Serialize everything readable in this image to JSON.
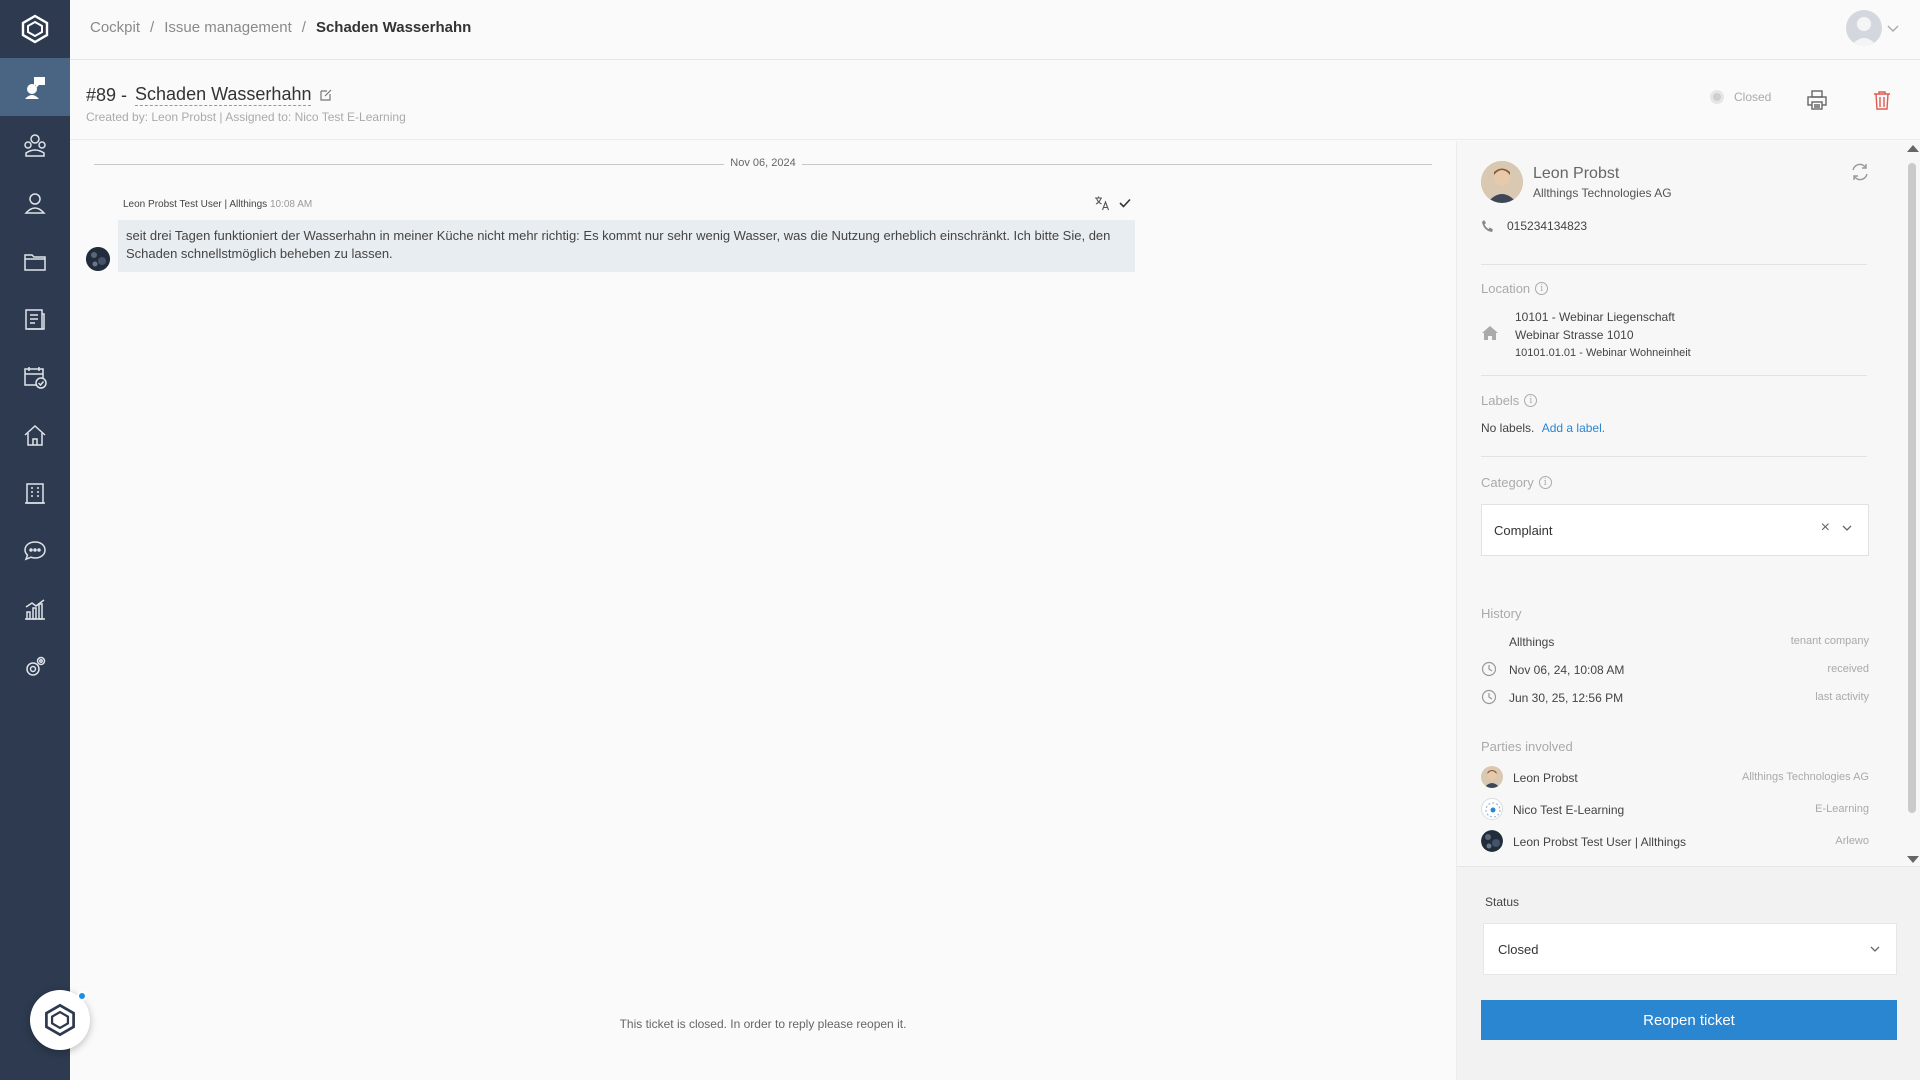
{
  "breadcrumb": {
    "items": [
      "Cockpit",
      "Issue management"
    ],
    "separator": "/",
    "current": "Schaden Wasserhahn"
  },
  "sidebar": {
    "items": [
      {
        "icon": "issue-management-icon",
        "active": true
      },
      {
        "icon": "team-icon"
      },
      {
        "icon": "user-icon"
      },
      {
        "icon": "folder-icon"
      },
      {
        "icon": "document-icon"
      },
      {
        "icon": "calendar-check-icon"
      },
      {
        "icon": "home-icon"
      },
      {
        "icon": "building-icon"
      },
      {
        "icon": "chat-icon"
      },
      {
        "icon": "analytics-icon"
      },
      {
        "icon": "settings-icon"
      }
    ]
  },
  "ticket": {
    "number": "#89 -",
    "title": "Schaden Wasserhahn",
    "meta": "Created by: Leon Probst | Assigned to: Nico Test E-Learning",
    "status_text": "Closed"
  },
  "conversation": {
    "date": "Nov 06, 2024",
    "message": {
      "author": "Leon Probst Test User | Allthings",
      "time": "10:08 AM",
      "text": "seit drei Tagen funktioniert der Wasserhahn in meiner Küche nicht mehr richtig: Es kommt nur sehr wenig Wasser, was die Nutzung erheblich einschränkt. Ich bitte Sie, den Schaden schnellstmöglich beheben zu lassen."
    },
    "closed_note": "This ticket is closed. In order to reply please reopen it."
  },
  "contact": {
    "name": "Leon Probst",
    "company": "Allthings Technologies AG",
    "phone": "015234134823"
  },
  "location": {
    "label": "Location",
    "line1": "10101 - Webinar Liegenschaft",
    "line2": "Webinar Strasse 1010",
    "line3": "10101.01.01 - Webinar Wohneinheit"
  },
  "labels": {
    "label": "Labels",
    "empty": "No labels.",
    "add_link": "Add a label."
  },
  "category": {
    "label": "Category",
    "value": "Complaint"
  },
  "history": {
    "label": "History",
    "rows": [
      {
        "text": "Allthings",
        "tag": "tenant company"
      },
      {
        "text": "Nov 06, 24, 10:08 AM",
        "tag": "received"
      },
      {
        "text": "Jun 30, 25, 12:56 PM",
        "tag": "last activity"
      }
    ]
  },
  "parties": {
    "label": "Parties involved",
    "rows": [
      {
        "name": "Leon Probst",
        "org": "Allthings Technologies AG"
      },
      {
        "name": "Nico Test E-Learning",
        "org": "E-Learning"
      },
      {
        "name": "Leon Probst Test User | Allthings",
        "org": "Arlewo"
      }
    ]
  },
  "status": {
    "label": "Status",
    "value": "Closed",
    "reopen_button": "Reopen ticket"
  },
  "colors": {
    "sidebar_bg": "#2d3a4f",
    "sidebar_active": "#4a6584",
    "primary": "#2a86d1",
    "delete": "#e05a4f"
  }
}
